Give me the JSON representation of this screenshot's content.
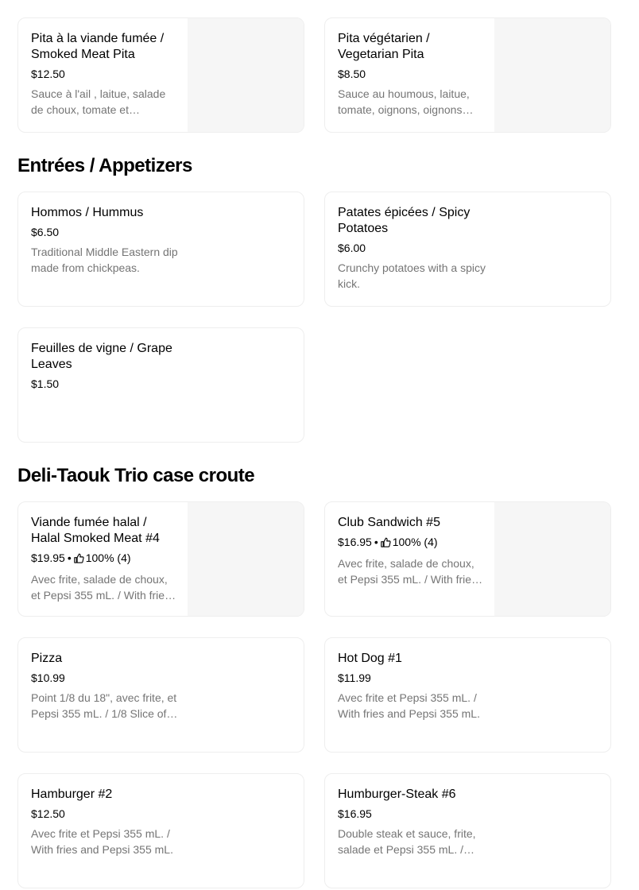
{
  "items": {
    "smoked_meat_pita": {
      "name": "Pita à la viande fumée / Smoked Meat Pita",
      "price": "$12.50",
      "description": "Sauce à l'ail , laitue, salade de choux, tomate et…"
    },
    "vegetarian_pita": {
      "name": "Pita végétarien / Vegetarian Pita",
      "price": "$8.50",
      "description": "Sauce au houmous, laitue, tomate, oignons, oignons…"
    }
  },
  "sections": {
    "appetizers": {
      "title": "Entrées / Appetizers",
      "items": [
        {
          "name": "Hommos / Hummus",
          "price": "$6.50",
          "description": "Traditional Middle Eastern dip made from chickpeas."
        },
        {
          "name": "Patates épicées / Spicy Potatoes",
          "price": "$6.00",
          "description": "Crunchy potatoes with a spicy kick."
        },
        {
          "name": "Feuilles de vigne / Grape Leaves",
          "price": "$1.50",
          "description": ""
        }
      ]
    },
    "trio": {
      "title": "Deli-Taouk Trio case croute",
      "items": [
        {
          "name": "Viande fumée halal / Halal Smoked Meat  #4",
          "price": "$19.95",
          "rating": "100% (4)",
          "description": "Avec frite, salade de choux, et Pepsi 355 mL. / With frie…"
        },
        {
          "name": "Club Sandwich #5",
          "price": "$16.95",
          "rating": "100% (4)",
          "description": "Avec frite, salade de choux, et Pepsi 355 mL. / With frie…"
        },
        {
          "name": "Pizza",
          "price": "$10.99",
          "description": "Point 1/8 du 18\", avec frite, et Pepsi 355 mL. / 1/8 Slice of…"
        },
        {
          "name": "Hot Dog #1",
          "price": "$11.99",
          "description": "Avec frite et Pepsi 355 mL. / With fries and Pepsi 355 mL."
        },
        {
          "name": "Hamburger #2",
          "price": "$12.50",
          "description": "Avec frite et Pepsi 355 mL. / With fries and Pepsi 355 mL."
        },
        {
          "name": "Humburger-Steak #6",
          "price": "$16.95",
          "description": "Double steak et sauce, frite, salade et Pepsi 355 mL. /…"
        }
      ]
    }
  },
  "rating_separator": "•",
  "icons": {
    "rating": "thumbs-up-icon"
  },
  "colors": {
    "text": "#000000",
    "muted": "#757575",
    "card_border": "#eeeeee",
    "image_placeholder": "#f6f6f6"
  }
}
